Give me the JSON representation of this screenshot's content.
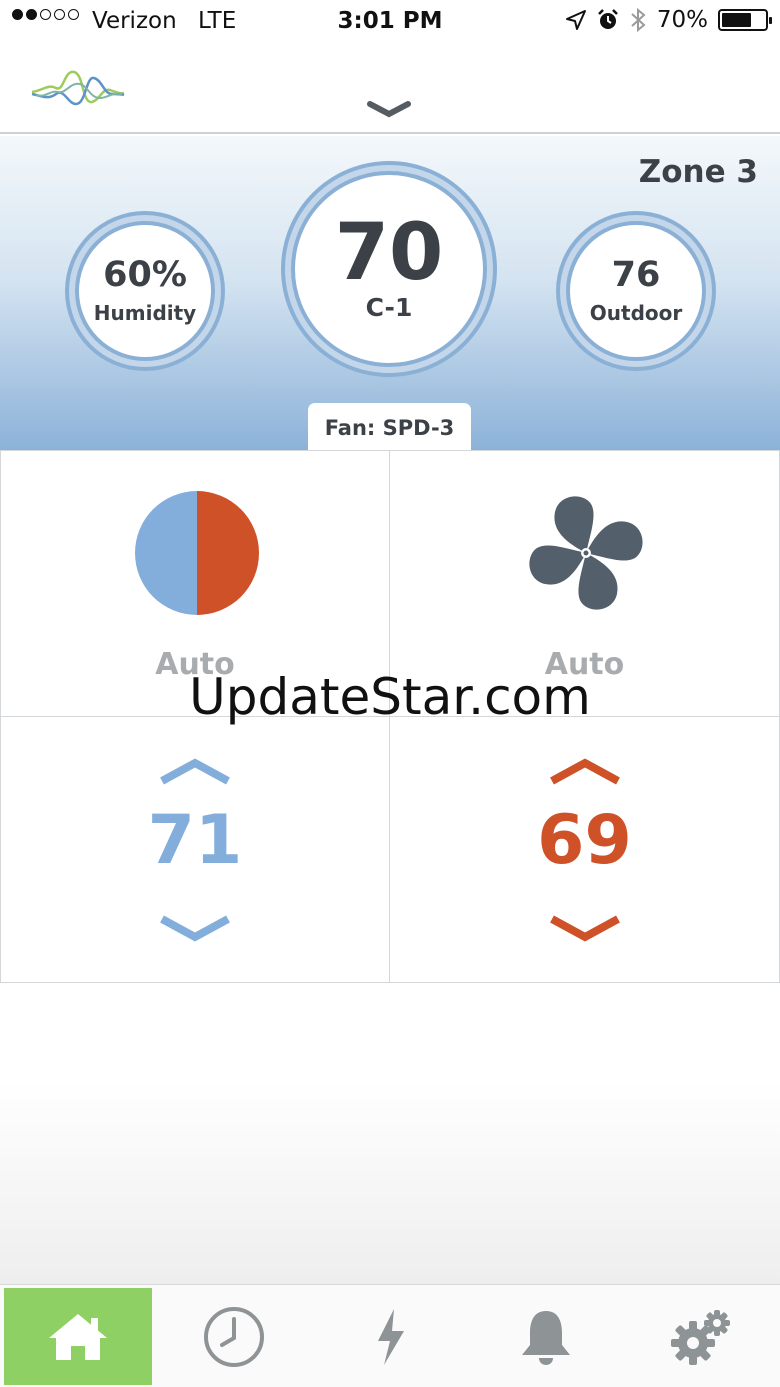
{
  "status_bar": {
    "carrier": "Verizon",
    "network": "LTE",
    "time": "3:01 PM",
    "battery_percent": "70%",
    "battery_level": 0.7,
    "signal_bars_filled": 2,
    "signal_bars_total": 5,
    "icons": [
      "location-arrow-icon",
      "alarm-clock-icon",
      "bluetooth-icon",
      "battery-icon"
    ]
  },
  "header": {
    "logo": "wave-logo",
    "collapse_icon": "chevron-down-icon"
  },
  "zone": {
    "name": "Zone 3",
    "humidity_value": "60%",
    "humidity_label": "Humidity",
    "current_temp": "70",
    "current_mode": "C-1",
    "outdoor_value": "76",
    "outdoor_label": "Outdoor",
    "fan_status": "Fan: SPD-3"
  },
  "controls": {
    "system_mode": {
      "icon": "heat-cool-split-icon",
      "label": "Auto"
    },
    "fan_mode": {
      "icon": "fan-icon",
      "label": "Auto"
    },
    "cool_setpoint": {
      "value": "71"
    },
    "heat_setpoint": {
      "value": "69"
    }
  },
  "watermark": "UpdateStar.com",
  "tab_bar": {
    "tabs": [
      {
        "name": "home",
        "icon": "home-icon",
        "active": true
      },
      {
        "name": "schedule",
        "icon": "clock-icon",
        "active": false
      },
      {
        "name": "energy",
        "icon": "lightning-icon",
        "active": false
      },
      {
        "name": "alerts",
        "icon": "bell-icon",
        "active": false
      },
      {
        "name": "settings",
        "icon": "gear-icon",
        "active": false
      }
    ]
  },
  "colors": {
    "cool": "#83aedb",
    "heat": "#cf5128",
    "ring": "#8bb0d6",
    "text_dark": "#3b4146",
    "text_muted": "#a9acaf",
    "fan_icon": "#535f6a",
    "tab_active": "#8fd064",
    "tab_icon": "#8e9396"
  }
}
